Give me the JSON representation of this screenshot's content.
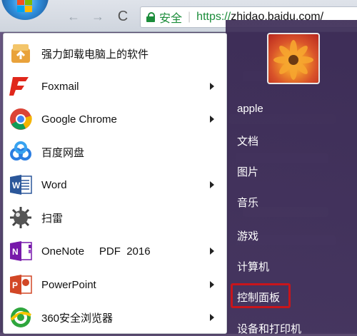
{
  "browser": {
    "back_glyph": "←",
    "forward_glyph": "→",
    "reload_glyph": "C",
    "secure_label": "安全",
    "address_separator": "|",
    "url_scheme": "https://",
    "url_host": "zhidao.baidu.com/"
  },
  "start_menu": {
    "programs": [
      {
        "label": "强力卸载电脑上的软件",
        "icon": "uninstall-icon",
        "has_submenu": false
      },
      {
        "label": "Foxmail",
        "icon": "foxmail-icon",
        "has_submenu": true
      },
      {
        "label": "Google Chrome",
        "icon": "chrome-icon",
        "has_submenu": true
      },
      {
        "label": "百度网盘",
        "icon": "baidu-netdisk-icon",
        "has_submenu": false
      },
      {
        "label": "Word",
        "icon": "word-icon",
        "has_submenu": true
      },
      {
        "label": "扫雷",
        "icon": "minesweeper-icon",
        "has_submenu": false
      },
      {
        "label": "OneNote     PDF  2016",
        "icon": "onenote-icon",
        "has_submenu": true
      },
      {
        "label": "PowerPoint",
        "icon": "powerpoint-icon",
        "has_submenu": true
      },
      {
        "label": "360安全浏览器",
        "icon": "360-browser-icon",
        "has_submenu": true
      }
    ],
    "right_items": [
      {
        "label": "apple"
      },
      {
        "label": "文档"
      },
      {
        "label": "图片"
      },
      {
        "label": "音乐"
      },
      {
        "label": "游戏"
      },
      {
        "label": "计算机"
      },
      {
        "label": "控制面板",
        "highlighted": true
      },
      {
        "label": "设备和打印机"
      }
    ],
    "highlight_color": "#c8151b"
  }
}
